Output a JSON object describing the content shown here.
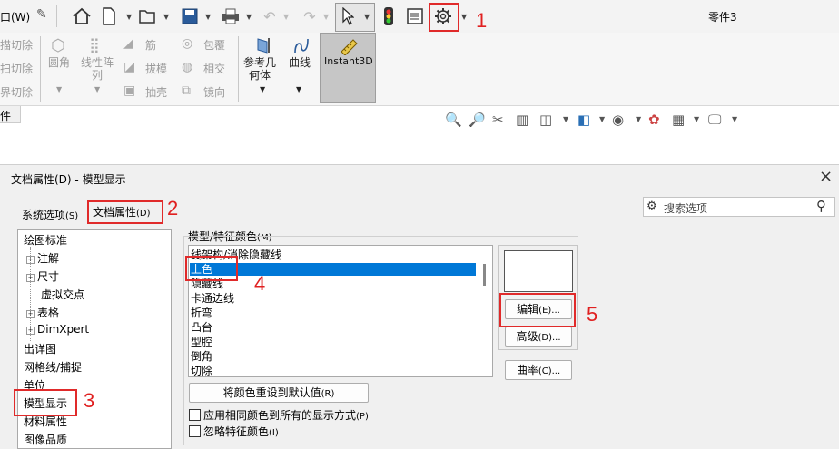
{
  "toolbar": {
    "left_label": "口(W)",
    "doc_title": "零件3",
    "icons": [
      "home-icon",
      "new-document-icon",
      "open-icon",
      "save-icon",
      "print-icon",
      "undo-icon",
      "redo-icon",
      "select-arrow-icon",
      "traffic-light-icon",
      "file-properties-icon",
      "options-gear-icon"
    ]
  },
  "ribbon": {
    "left_items": [
      "描切除",
      "扫切除",
      "界切除"
    ],
    "group1": {
      "fillet": "圆角",
      "pattern_line1": "线性阵",
      "pattern_line2": "列"
    },
    "group2": {
      "rib": "筋",
      "draft": "拔模",
      "shell": "抽壳"
    },
    "group3": {
      "wrap": "包覆",
      "intersect": "相交",
      "mirror": "镜向"
    },
    "ref_geom_line1": "参考几",
    "ref_geom_line2": "何体",
    "curves": "曲线",
    "instant3d": "Instant3D"
  },
  "strip2": {
    "left_label": "件"
  },
  "dialog": {
    "title": "文档属性(D) - 模型显示",
    "close": "×",
    "tab_system": "系统选项",
    "tab_system_key": "(S)",
    "tab_doc": "文档属性",
    "tab_doc_key": "(D)",
    "search_placeholder": "搜索选项",
    "tree": [
      "绘图标准",
      "注解",
      "尺寸",
      "虚拟交点",
      "表格",
      "DimXpert",
      "出详图",
      "网格线/捕捉",
      "单位",
      "模型显示",
      "材料属性",
      "图像品质"
    ],
    "color_group_label": "模型/特征颜色",
    "color_group_key": "(M)",
    "color_list": [
      "线架构/消除隐藏线",
      "上色",
      "隐藏线",
      "卡通边线",
      "折弯",
      "凸台",
      "型腔",
      "倒角",
      "切除"
    ],
    "selected_index": 1,
    "edit_btn": "编辑",
    "edit_key": "(E)...",
    "advanced_btn": "高级",
    "advanced_key": "(D)...",
    "curvature_btn": "曲率",
    "curvature_key": "(C)...",
    "reset_btn": "将颜色重设到默认值",
    "reset_key": "(R)",
    "apply_same_label": "应用相同颜色到所有的显示方式",
    "apply_same_key": "(P)",
    "ignore_feature_label": "忽略特征颜色",
    "ignore_feature_key": "(I)"
  },
  "annotations": [
    "1",
    "2",
    "3",
    "4",
    "5"
  ],
  "colors": {
    "selection": "#0078d7",
    "annotation_red": "#e02a2a"
  }
}
